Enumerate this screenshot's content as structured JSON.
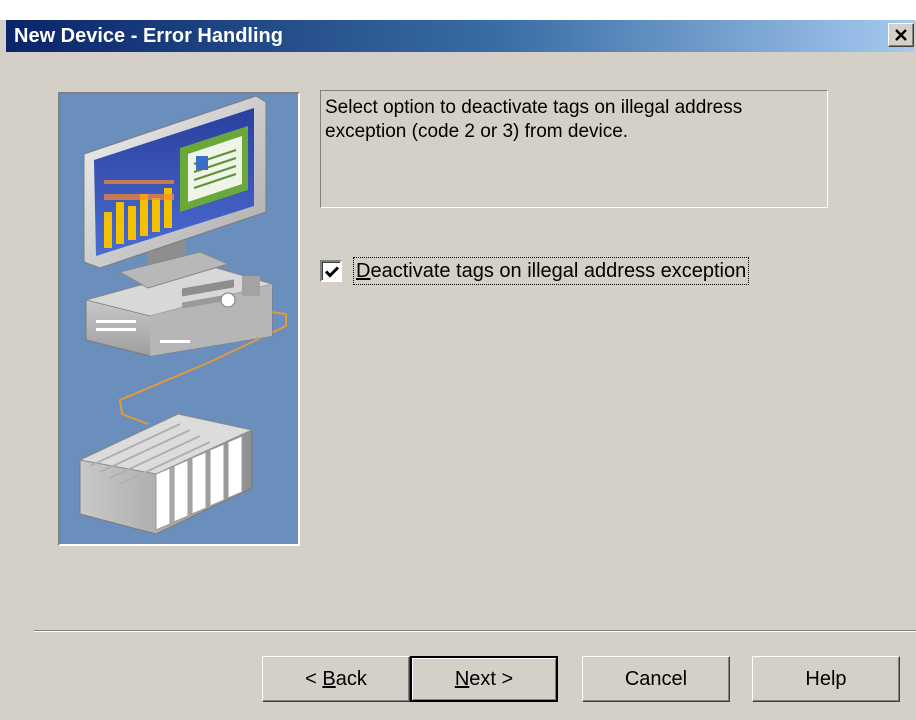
{
  "window": {
    "title": "New Device - Error Handling"
  },
  "description": {
    "text": "Select option to deactivate tags on illegal address exception (code 2 or 3) from device."
  },
  "options": {
    "deactivate_tags": {
      "label_mnemonic": "D",
      "label_rest": "eactivate tags on illegal address exception",
      "checked": true
    }
  },
  "buttons": {
    "back_prefix": "< ",
    "back_mnemonic": "B",
    "back_rest": "ack",
    "next_mnemonic": "N",
    "next_rest": "ext >",
    "cancel": "Cancel",
    "help": "Help"
  },
  "colors": {
    "dialog_bg": "#d4d0c8",
    "title_start": "#0a246a",
    "title_end": "#a6caf0",
    "illustration_bg": "#6b8fbd"
  },
  "icons": {
    "close": "close-icon",
    "check": "check-icon",
    "illustration": "computer-network-device-illustration"
  }
}
